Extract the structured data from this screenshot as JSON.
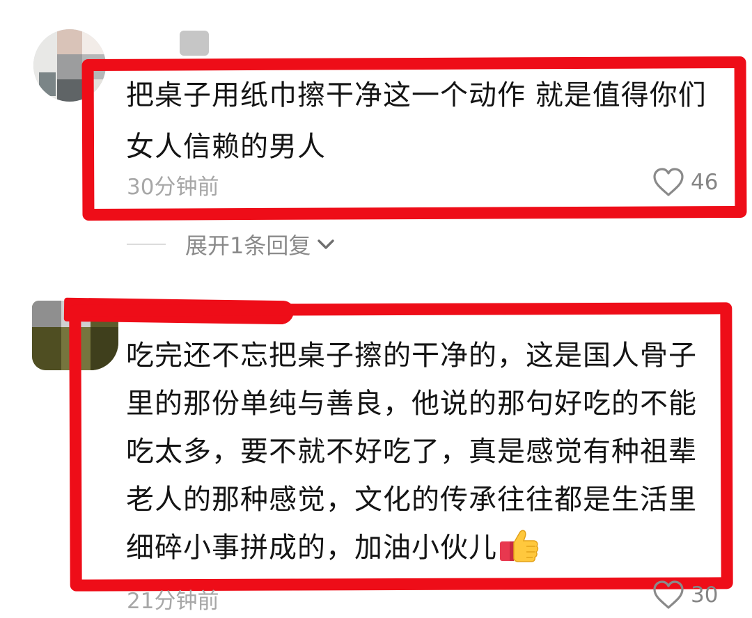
{
  "comments": [
    {
      "text": "把桌子用纸巾擦干净这一个动作 就是值得你们女人信赖的男人",
      "time": "30分钟前",
      "likes": "46",
      "replies_label": "展开1条回复",
      "highlight_color": "#ee0d18"
    },
    {
      "text": "吃完还不忘把桌子擦的干净的，这是国人骨子里的那份单纯与善良，他说的那句好吃的不能吃太多，要不就不好吃了，真是感觉有种祖辈老人的那种感觉，文化的传承往往都是生活里细碎小事拼成的，加油小伙儿",
      "emoji": "thumbs-up-emoji",
      "time": "21分钟前",
      "likes": "30",
      "highlight_color": "#ee0d18"
    }
  ],
  "icons": {
    "like": "heart-outline-icon",
    "expand": "chevron-down-icon"
  }
}
